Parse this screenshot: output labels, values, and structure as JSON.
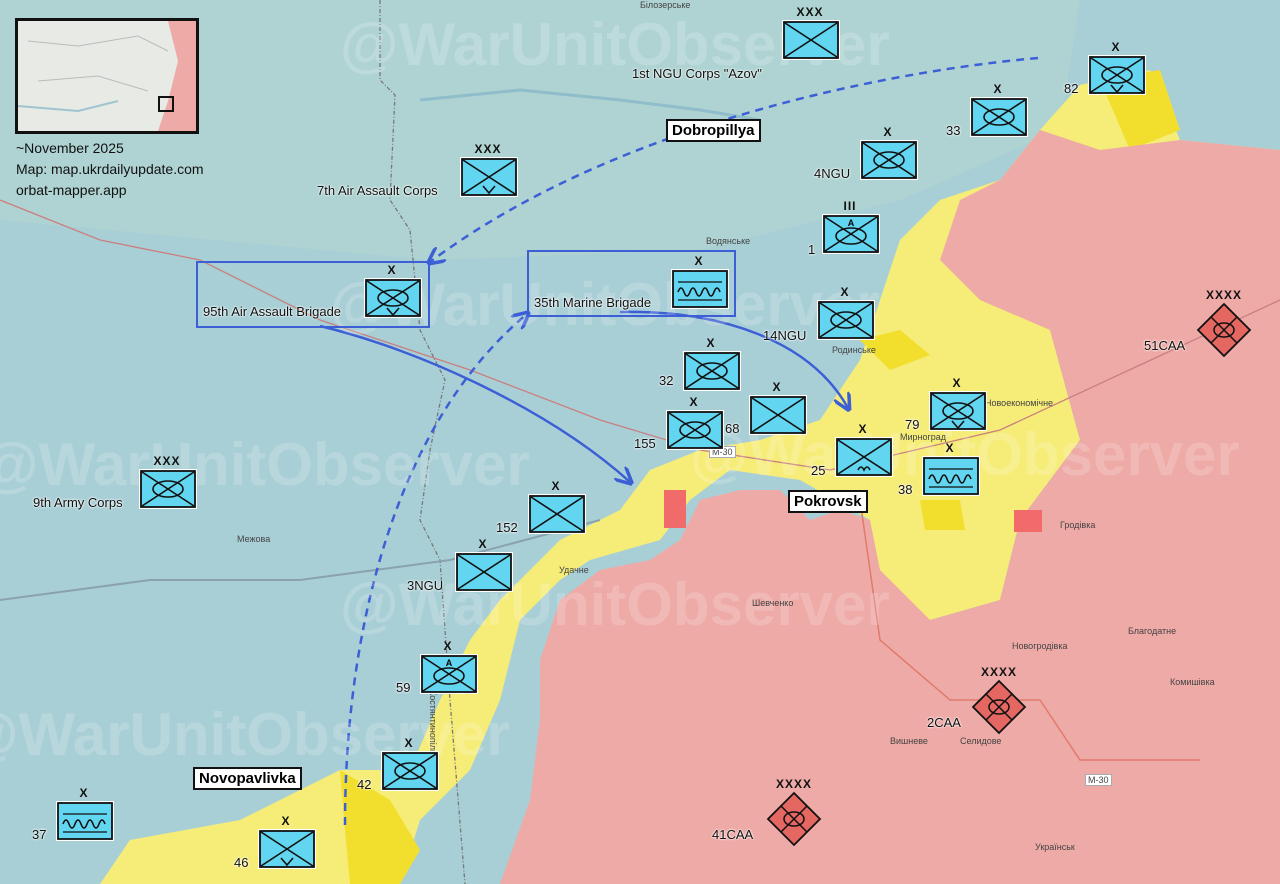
{
  "colors": {
    "ukraine_area": "#a9cfd6",
    "russian_area": "#eeaaa6",
    "contested_area": "#f6ec78",
    "contested_strong": "#f2de2c",
    "unit_fill": "#62d5f0",
    "russian_unit_fill": "#e46762",
    "arrow": "#3d5fd6"
  },
  "credits": {
    "date": "~November 2025",
    "map_source": "Map: map.ukrdailyupdate.com",
    "app": "orbat-mapper.app"
  },
  "watermark": "@WarUnitObserver",
  "cities": {
    "dobropillya": "Dobropillya",
    "pokrovsk": "Pokrovsk",
    "novopavlivka": "Novopavlivka"
  },
  "boxes": {
    "air_assault_95": "95th Air Assault Brigade",
    "marine_35": "35th Marine Brigade"
  },
  "place_names": {
    "bilozerske": "Білозерське",
    "vodianske": "Водянське",
    "rodynske": "Родинське",
    "novoekonomichne": "Новоекономічне",
    "myrnohrad": "Мирноград",
    "hrodivka": "Гродівка",
    "mezhova": "Межова",
    "udachne": "Удачне",
    "shevchenko": "Шевченко",
    "blahodatne": "Благодатне",
    "novohrodivka": "Новогродівка",
    "komyshivka": "Комишівка",
    "selydove": "Селидове",
    "vyshneve": "Вишневе",
    "ukrainsk": "Українськ",
    "kostiantynopil": "Костянтинопіль",
    "road_m30": "М-30"
  },
  "units": [
    {
      "id": "1st-ngu-corps",
      "label": "1st NGU Corps \"Azov\"",
      "echelon": "XXX",
      "symbol": "infantry"
    },
    {
      "id": "82",
      "label": "82",
      "echelon": "X",
      "symbol": "air-assault"
    },
    {
      "id": "33",
      "label": "33",
      "echelon": "X",
      "symbol": "mechanized"
    },
    {
      "id": "4ngu",
      "label": "4NGU",
      "echelon": "X",
      "symbol": "mechanized"
    },
    {
      "id": "1x",
      "label": "1",
      "echelon": "III",
      "symbol": "armored-a"
    },
    {
      "id": "14ngu",
      "label": "14NGU",
      "echelon": "X",
      "symbol": "mechanized"
    },
    {
      "id": "7th-aac",
      "label": "7th Air Assault Corps",
      "echelon": "XXX",
      "symbol": "airborne"
    },
    {
      "id": "95-aab",
      "label": "",
      "echelon": "X",
      "symbol": "air-assault"
    },
    {
      "id": "35-mb",
      "label": "",
      "echelon": "X",
      "symbol": "marine"
    },
    {
      "id": "32",
      "label": "32",
      "echelon": "X",
      "symbol": "mechanized"
    },
    {
      "id": "155",
      "label": "155",
      "echelon": "X",
      "symbol": "mechanized"
    },
    {
      "id": "68",
      "label": "68",
      "echelon": "X",
      "symbol": "infantry"
    },
    {
      "id": "79",
      "label": "79",
      "echelon": "X",
      "symbol": "air-assault"
    },
    {
      "id": "25",
      "label": "25",
      "echelon": "X",
      "symbol": "airborne-v"
    },
    {
      "id": "38",
      "label": "38",
      "echelon": "X",
      "symbol": "marine"
    },
    {
      "id": "9th-army-corps",
      "label": "9th Army Corps",
      "echelon": "XXX",
      "symbol": "mechanized"
    },
    {
      "id": "152",
      "label": "152",
      "echelon": "X",
      "symbol": "infantry"
    },
    {
      "id": "3ngu",
      "label": "3NGU",
      "echelon": "X",
      "symbol": "infantry"
    },
    {
      "id": "59",
      "label": "59",
      "echelon": "X",
      "symbol": "armored-a"
    },
    {
      "id": "42",
      "label": "42",
      "echelon": "X",
      "symbol": "mechanized"
    },
    {
      "id": "37",
      "label": "37",
      "echelon": "X",
      "symbol": "marine"
    },
    {
      "id": "46",
      "label": "46",
      "echelon": "X",
      "symbol": "airborne"
    }
  ],
  "enemy_units": [
    {
      "id": "51caa",
      "label": "51CAA",
      "echelon": "XXXX"
    },
    {
      "id": "2caa",
      "label": "2CAA",
      "echelon": "XXXX"
    },
    {
      "id": "41caa",
      "label": "41CAA",
      "echelon": "XXXX"
    }
  ]
}
